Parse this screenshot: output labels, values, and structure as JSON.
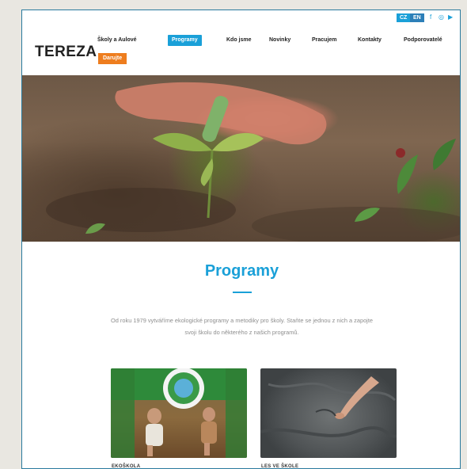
{
  "topbar": {
    "utility_text": "",
    "languages": [
      "CZ",
      "EN"
    ],
    "social_icons": [
      "facebook-icon",
      "instagram-icon",
      "youtube-icon"
    ]
  },
  "header": {
    "logo": "TEREZA",
    "nav": [
      {
        "label": "Školy a Aulové",
        "active": false
      },
      {
        "label": "Programy",
        "active": true
      },
      {
        "label": "Kdo jsme",
        "active": false
      },
      {
        "label": "Novinky",
        "active": false
      },
      {
        "label": "Pracujem",
        "active": false
      },
      {
        "label": "Kontakty",
        "active": false
      },
      {
        "label": "Podporovatelé",
        "active": false
      }
    ],
    "cta": "Darujte",
    "colors": {
      "accent": "#1aa0d8",
      "cta": "#ee7d1e"
    }
  },
  "main": {
    "title": "Programy",
    "intro": "Od roku 1979 vytváříme ekologické programy a metodiky pro školy. Staňte se jednou z nich a zapojte svoji školu do některého z našich programů.",
    "cards": [
      {
        "label": "EKOŠKOLA"
      },
      {
        "label": "LES VE ŠKOLE"
      }
    ]
  }
}
